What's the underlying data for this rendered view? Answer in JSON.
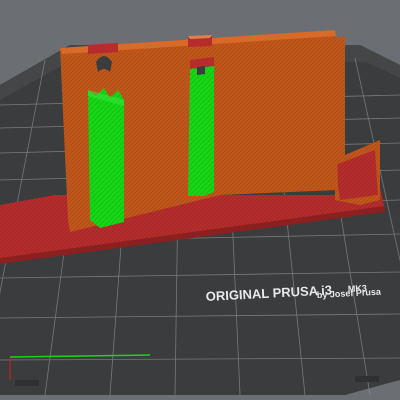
{
  "viewport": {
    "type": "3D slicer preview",
    "bed_label_line1": "ORIGINAL PRUSA i3",
    "bed_label_model": "MK3",
    "bed_label_line2": "by Josef Prusa",
    "colors": {
      "background": "#6b6f74",
      "bed": "#3b3c3e",
      "grid": "#8c8d8f",
      "perimeter": "#c0561a",
      "infill": "#b52c2c",
      "support": "#17d617",
      "axis_x": "#d81d1d",
      "axis_y": "#1fd01f"
    },
    "icons": [
      "print-bed",
      "printed-model",
      "x-axis-icon",
      "y-axis-icon"
    ]
  }
}
